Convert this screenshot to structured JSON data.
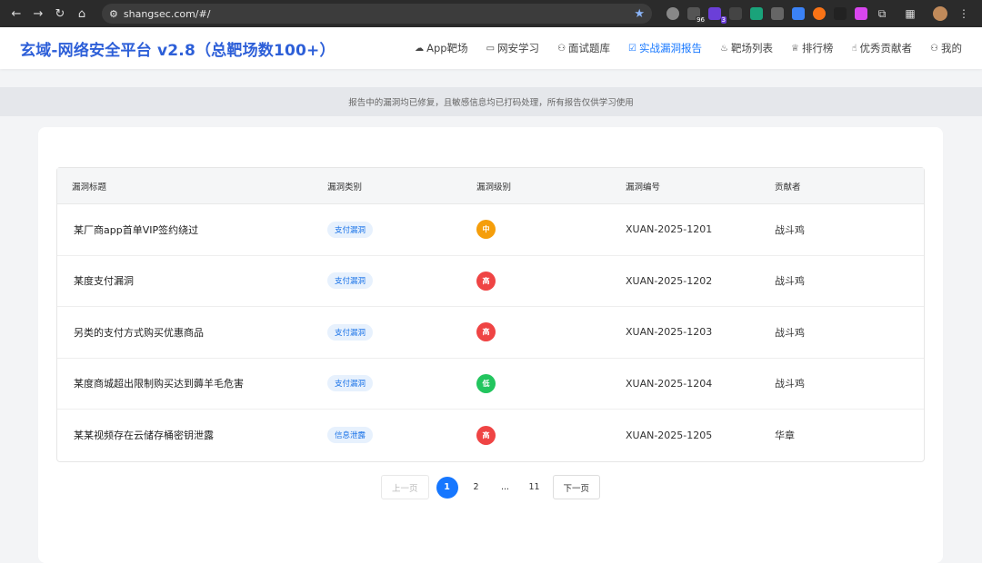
{
  "browser": {
    "url": "shangsec.com/#/",
    "ext_badges": [
      "96",
      "3"
    ]
  },
  "site": {
    "logo": "玄域-网络安全平台 v2.8（总靶场数100+）",
    "nav": [
      {
        "label": "App靶场",
        "icon": "cloud-icon"
      },
      {
        "label": "网安学习",
        "icon": "book-icon"
      },
      {
        "label": "面试题库",
        "icon": "user-icon"
      },
      {
        "label": "实战漏洞报告",
        "icon": "check-square-icon",
        "active": true
      },
      {
        "label": "靶场列表",
        "icon": "flame-icon"
      },
      {
        "label": "排行榜",
        "icon": "trophy-icon"
      },
      {
        "label": "优秀贡献者",
        "icon": "thumbs-up-icon"
      },
      {
        "label": "我的",
        "icon": "user-icon"
      }
    ],
    "notice": "报告中的漏洞均已修复，且敏感信息均已打码处理，所有报告仅供学习使用"
  },
  "table": {
    "headers": [
      "漏洞标题",
      "漏洞类别",
      "漏洞级别",
      "漏洞编号",
      "贡献者"
    ],
    "rows": [
      {
        "title": "某厂商app首单VIP签约绕过",
        "category": "支付漏洞",
        "level": "中",
        "level_color": "#f59e0b",
        "id": "XUAN-2025-1201",
        "contributor": "战斗鸡"
      },
      {
        "title": "某度支付漏洞",
        "category": "支付漏洞",
        "level": "高",
        "level_color": "#ef4444",
        "id": "XUAN-2025-1202",
        "contributor": "战斗鸡"
      },
      {
        "title": "另类的支付方式购买优惠商品",
        "category": "支付漏洞",
        "level": "高",
        "level_color": "#ef4444",
        "id": "XUAN-2025-1203",
        "contributor": "战斗鸡"
      },
      {
        "title": "某度商城超出限制购买达到薅羊毛危害",
        "category": "支付漏洞",
        "level": "低",
        "level_color": "#22c55e",
        "id": "XUAN-2025-1204",
        "contributor": "战斗鸡"
      },
      {
        "title": "某某视频存在云储存桶密钥泄露",
        "category": "信息泄露",
        "level": "高",
        "level_color": "#ef4444",
        "id": "XUAN-2025-1205",
        "contributor": "华章"
      }
    ]
  },
  "pagination": {
    "prev": "上一页",
    "pages": [
      "1",
      "2",
      "...",
      "11"
    ],
    "current": "1",
    "next": "下一页"
  },
  "colors": {
    "accent": "#1677ff",
    "logo": "#2d5fd8"
  }
}
